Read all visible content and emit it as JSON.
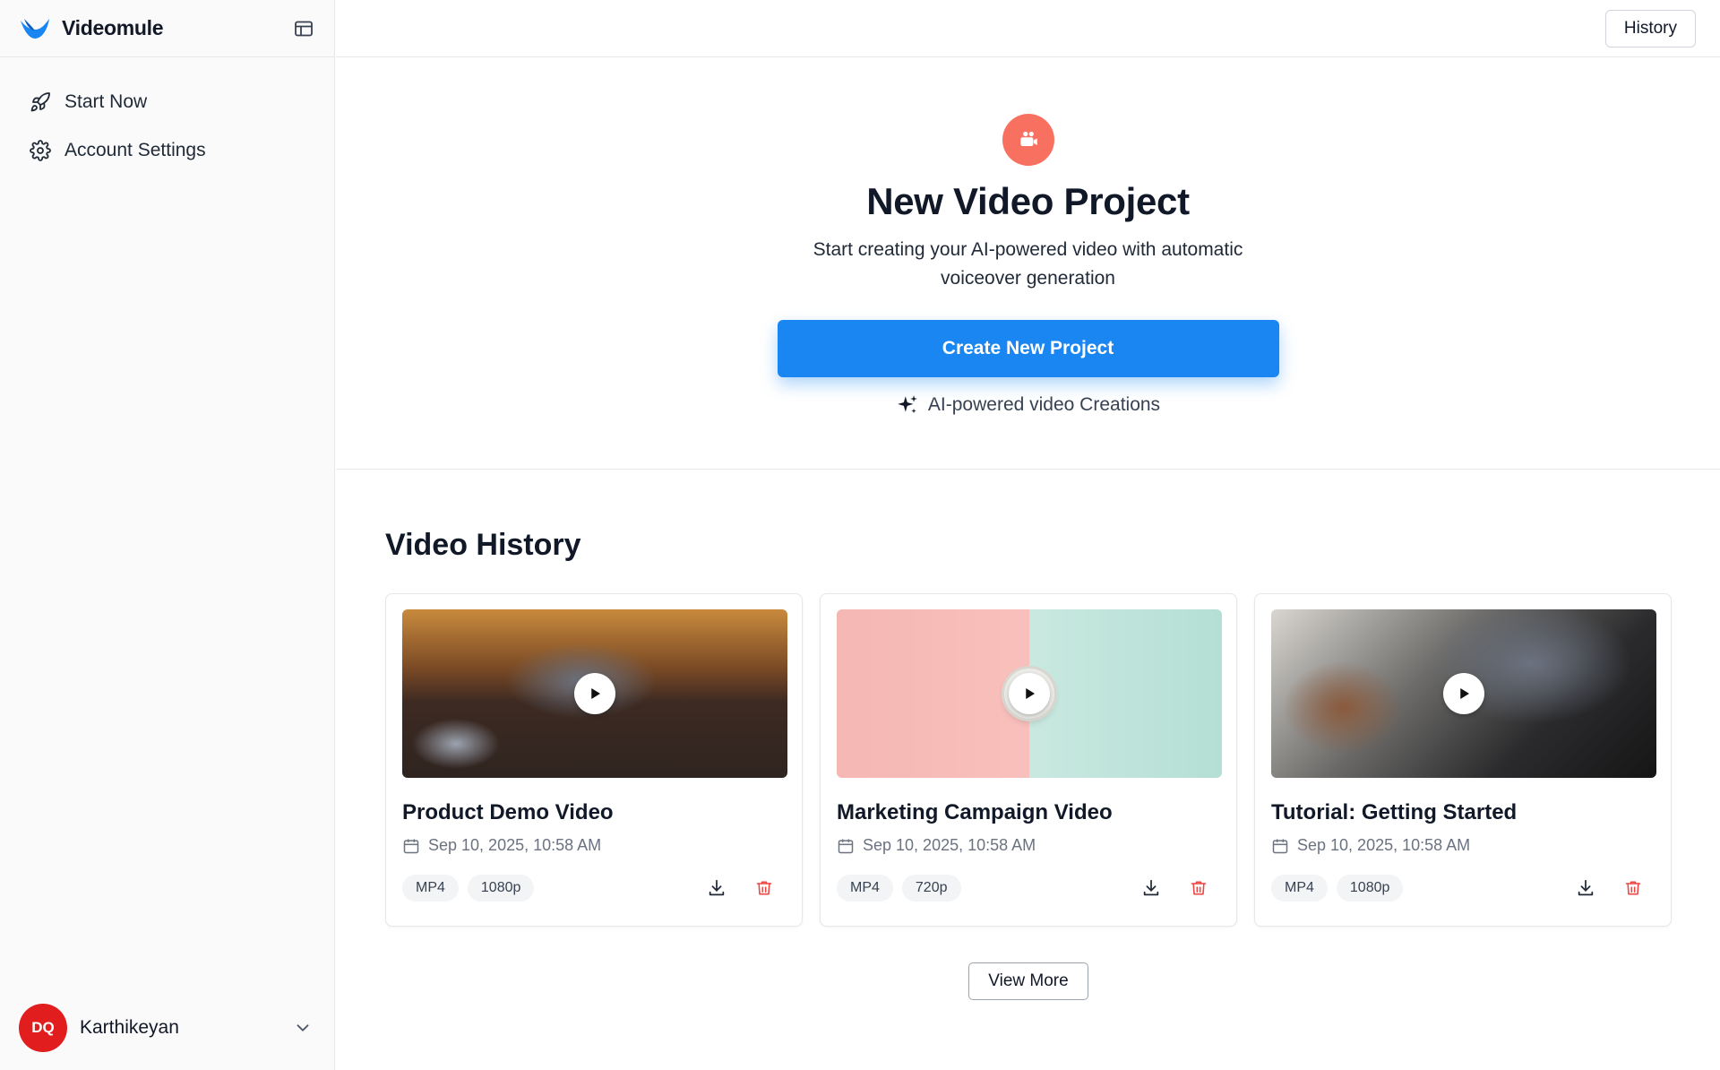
{
  "app": {
    "name": "Videomule",
    "brand_color": "#1a86f2"
  },
  "sidebar": {
    "items": [
      {
        "label": "Start Now",
        "icon": "rocket-icon"
      },
      {
        "label": "Account Settings",
        "icon": "gear-icon"
      }
    ],
    "user": {
      "initials": "DQ",
      "name": "Karthikeyan",
      "avatar_color": "#e11d1d"
    }
  },
  "header": {
    "history_label": "History"
  },
  "hero": {
    "title": "New Video Project",
    "subtitle": "Start creating your AI-powered video with automatic voiceover generation",
    "cta_label": "Create New Project",
    "note": "AI-powered video Creations",
    "icon": "video-camera-icon",
    "icon_color": "#f87160"
  },
  "history": {
    "title": "Video History",
    "cards": [
      {
        "title": "Product Demo Video",
        "date": "Sep 10, 2025, 10:58 AM",
        "format": "MP4",
        "resolution": "1080p"
      },
      {
        "title": "Marketing Campaign Video",
        "date": "Sep 10, 2025, 10:58 AM",
        "format": "MP4",
        "resolution": "720p"
      },
      {
        "title": "Tutorial: Getting Started",
        "date": "Sep 10, 2025, 10:58 AM",
        "format": "MP4",
        "resolution": "1080p"
      }
    ],
    "view_more_label": "View More"
  }
}
